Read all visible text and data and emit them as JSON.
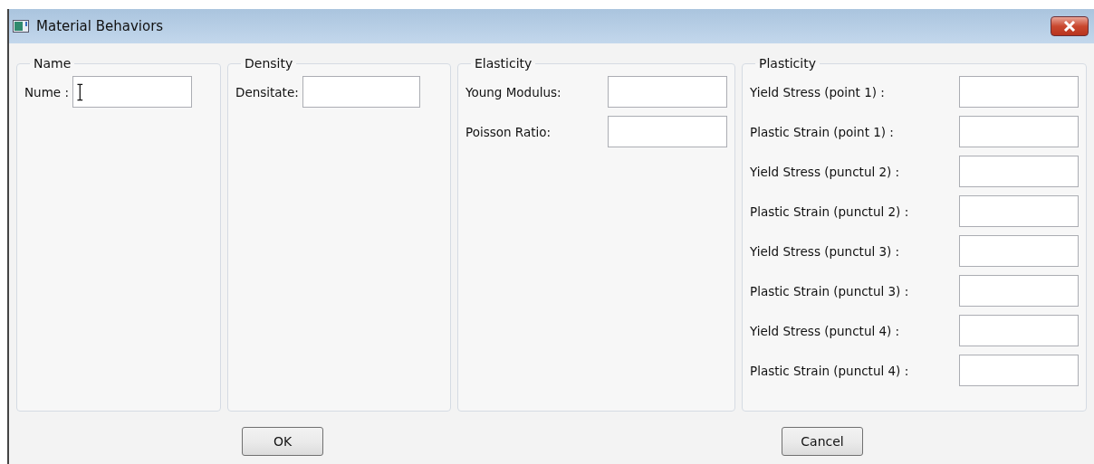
{
  "window": {
    "title": "Material Behaviors"
  },
  "groups": [
    {
      "title": "Name",
      "fields": [
        {
          "label": "Nume :",
          "cursor": true
        }
      ]
    },
    {
      "title": "Density",
      "fields": [
        {
          "label": "Densitate:"
        }
      ]
    },
    {
      "title": "Elasticity",
      "fields": [
        {
          "label": "Young Modulus:"
        },
        {
          "label": "Poisson Ratio:"
        }
      ]
    },
    {
      "title": "Plasticity",
      "fields": [
        {
          "label": "Yield Stress (point 1) :"
        },
        {
          "label": "Plastic Strain (point 1) :"
        },
        {
          "label": "Yield Stress (punctul 2) :"
        },
        {
          "label": "Plastic Strain (punctul 2) :"
        },
        {
          "label": "Yield Stress (punctul 3) :"
        },
        {
          "label": "Plastic Strain (punctul 3) :"
        },
        {
          "label": "Yield Stress (punctul 4) :"
        },
        {
          "label": "Plastic Strain (punctul 4) :"
        }
      ]
    }
  ],
  "buttons": [
    "OK",
    "Cancel"
  ]
}
